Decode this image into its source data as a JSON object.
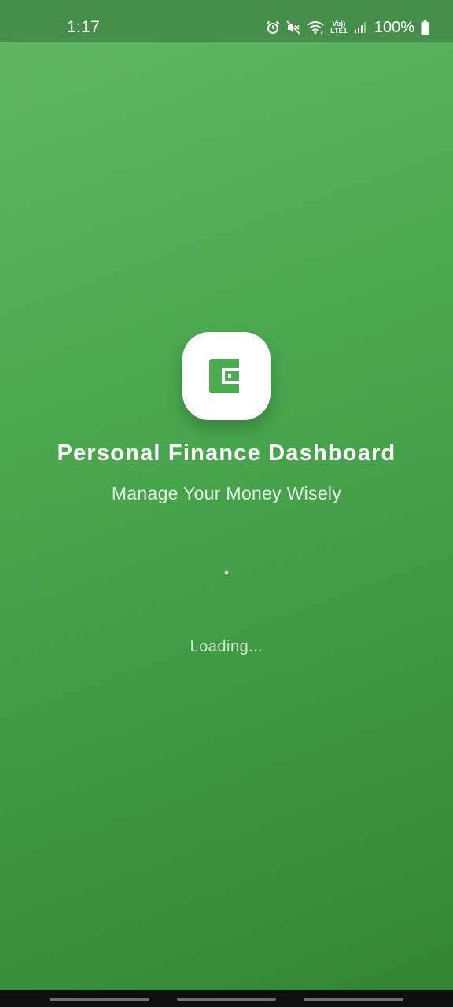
{
  "status_bar": {
    "time": "1:17",
    "network_label": "Vo)) LTE1",
    "battery": "100%",
    "icons": [
      "alarm-icon",
      "mute-icon",
      "wifi-icon",
      "volte-icon",
      "signal-icon",
      "battery-icon"
    ]
  },
  "splash": {
    "logo_icon": "wallet-icon",
    "title": "Personal Finance Dashboard",
    "subtitle": "Manage Your Money Wisely",
    "loading_text": "Loading..."
  },
  "colors": {
    "background_top": "#61b865",
    "background_bottom": "#338434",
    "status_bar": "#468f4a",
    "logo_green": "#4caa50",
    "text": "#ffffff"
  }
}
